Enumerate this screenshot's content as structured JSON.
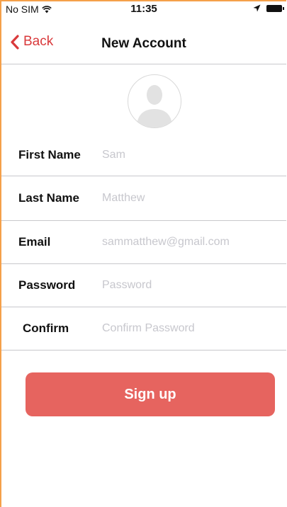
{
  "status_bar": {
    "carrier": "No SIM",
    "time": "11:35"
  },
  "nav": {
    "back_label": "Back",
    "title": "New Account"
  },
  "form": {
    "fields": [
      {
        "label": "First Name",
        "placeholder": "Sam"
      },
      {
        "label": "Last Name",
        "placeholder": "Matthew"
      },
      {
        "label": "Email",
        "placeholder": "sammatthew@gmail.com"
      },
      {
        "label": "Password",
        "placeholder": "Password"
      },
      {
        "label": "Confirm",
        "placeholder": "Confirm Password"
      }
    ]
  },
  "signup_label": "Sign up",
  "colors": {
    "accent": "#d9393b",
    "button": "#e6645f",
    "separator": "#c8c8cc",
    "placeholder": "#c7c7cd"
  },
  "icons": [
    "wifi-icon",
    "location-arrow-icon",
    "battery-icon",
    "chevron-left-icon",
    "avatar-placeholder-icon"
  ]
}
